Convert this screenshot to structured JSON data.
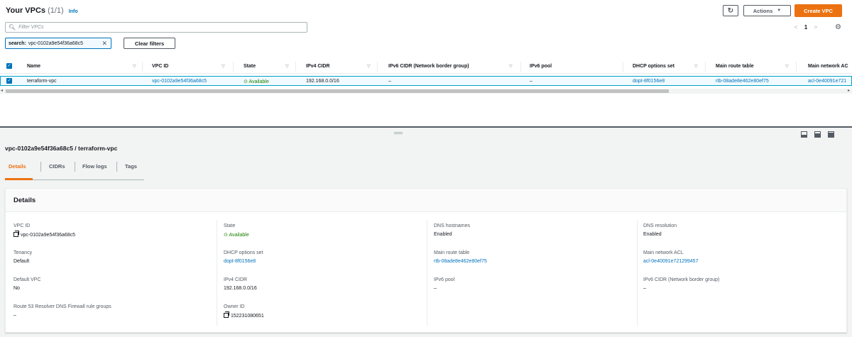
{
  "header": {
    "title": "Your VPCs",
    "count": "(1/1)",
    "info": "Info",
    "refresh_icon": "↻",
    "actions_label": "Actions",
    "create_label": "Create VPC"
  },
  "search": {
    "placeholder": "Filter VPCs"
  },
  "pagination": {
    "prev": "<",
    "page": "1",
    "next": ">"
  },
  "filter_token": {
    "key": "search:",
    "value": "vpc-0102a9e54f36a68c5"
  },
  "clear_filters_label": "Clear filters",
  "table": {
    "columns": [
      "Name",
      "VPC ID",
      "State",
      "IPv4 CIDR",
      "IPv6 CIDR (Network border group)",
      "IPv6 pool",
      "DHCP options set",
      "Main route table",
      "Main network AC"
    ],
    "rows": [
      {
        "name": "terraform-vpc",
        "vpc_id": "vpc-0102a9e54f36a68c5",
        "state": "Available",
        "ipv4": "192.168.0.0/16",
        "ipv6": "–",
        "ipv6_pool": "–",
        "dhcp": "dopt-8f0156e8",
        "route_table": "rtb-08ade8e462e80ef75",
        "acl": "acl-0e40091e721"
      }
    ]
  },
  "split": {
    "title": "vpc-0102a9e54f36a68c5 / terraform-vpc",
    "tabs": [
      "Details",
      "CIDRs",
      "Flow logs",
      "Tags"
    ]
  },
  "details": {
    "title": "Details",
    "col1": [
      {
        "label": "VPC ID",
        "value": "vpc-0102a9e54f36a68c5"
      },
      {
        "label": "Tenancy",
        "value": "Default"
      },
      {
        "label": "Default VPC",
        "value": "No"
      },
      {
        "label": "Route 53 Resolver DNS Firewall rule groups",
        "value": "–"
      }
    ],
    "col2": [
      {
        "label": "State",
        "value": "Available"
      },
      {
        "label": "DHCP options set",
        "value": "dopt-8f0156e8"
      },
      {
        "label": "IPv4 CIDR",
        "value": "192.168.0.0/16"
      },
      {
        "label": "Owner ID",
        "value": "152231080651"
      }
    ],
    "col3": [
      {
        "label": "DNS hostnames",
        "value": "Enabled"
      },
      {
        "label": "Main route table",
        "value": "rtb-08ade8e462e80ef75"
      },
      {
        "label": "IPv6 pool",
        "value": "–"
      }
    ],
    "col4": [
      {
        "label": "DNS resolution",
        "value": "Enabled"
      },
      {
        "label": "Main network ACL",
        "value": "acl-0e40091e721299457"
      },
      {
        "label": "IPv6 CIDR (Network border group)",
        "value": "–"
      }
    ]
  },
  "colors": {
    "accent": "#ec7211",
    "link": "#0073bb",
    "success": "#1d8102"
  }
}
